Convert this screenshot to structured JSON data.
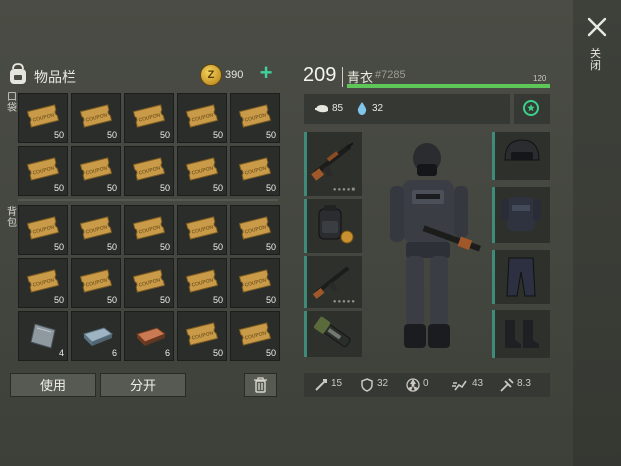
{
  "inventory": {
    "title": "物品栏",
    "coins": "390",
    "coin_letter": "Z",
    "pocket_label": "口袋",
    "backpack_label": "背包",
    "coupon_text": "COUPON",
    "pockets": [
      {
        "item": "coupon",
        "qty": "50"
      },
      {
        "item": "coupon",
        "qty": "50"
      },
      {
        "item": "coupon",
        "qty": "50"
      },
      {
        "item": "coupon",
        "qty": "50"
      },
      {
        "item": "coupon",
        "qty": "50"
      },
      {
        "item": "coupon",
        "qty": "50"
      },
      {
        "item": "coupon",
        "qty": "50"
      },
      {
        "item": "coupon",
        "qty": "50"
      },
      {
        "item": "coupon",
        "qty": "50"
      },
      {
        "item": "coupon",
        "qty": "50"
      }
    ],
    "backpack": [
      {
        "item": "coupon",
        "qty": "50"
      },
      {
        "item": "coupon",
        "qty": "50"
      },
      {
        "item": "coupon",
        "qty": "50"
      },
      {
        "item": "coupon",
        "qty": "50"
      },
      {
        "item": "coupon",
        "qty": "50"
      },
      {
        "item": "coupon",
        "qty": "50"
      },
      {
        "item": "coupon",
        "qty": "50"
      },
      {
        "item": "coupon",
        "qty": "50"
      },
      {
        "item": "coupon",
        "qty": "50"
      },
      {
        "item": "coupon",
        "qty": "50"
      },
      {
        "item": "steel-plate",
        "qty": "4"
      },
      {
        "item": "iron-bar",
        "qty": "6"
      },
      {
        "item": "copper-bar",
        "qty": "6"
      },
      {
        "item": "coupon",
        "qty": "50"
      },
      {
        "item": "coupon",
        "qty": "50"
      }
    ],
    "use_button": "使用",
    "split_button": "分开"
  },
  "character": {
    "level": "209",
    "name": "青衣",
    "id": "#7285",
    "hp": "120",
    "hp_fraction": 1.0,
    "food": "85",
    "water": "32",
    "stats": {
      "attack": "15",
      "defense": "32",
      "radiation": "0",
      "speed": "43",
      "weapon": "8.3"
    }
  },
  "close_label": "关闭",
  "colors": {
    "accent_green": "#3fd29b",
    "hp_green": "#5fc75a",
    "slot_edge": "#3e8b7a"
  }
}
